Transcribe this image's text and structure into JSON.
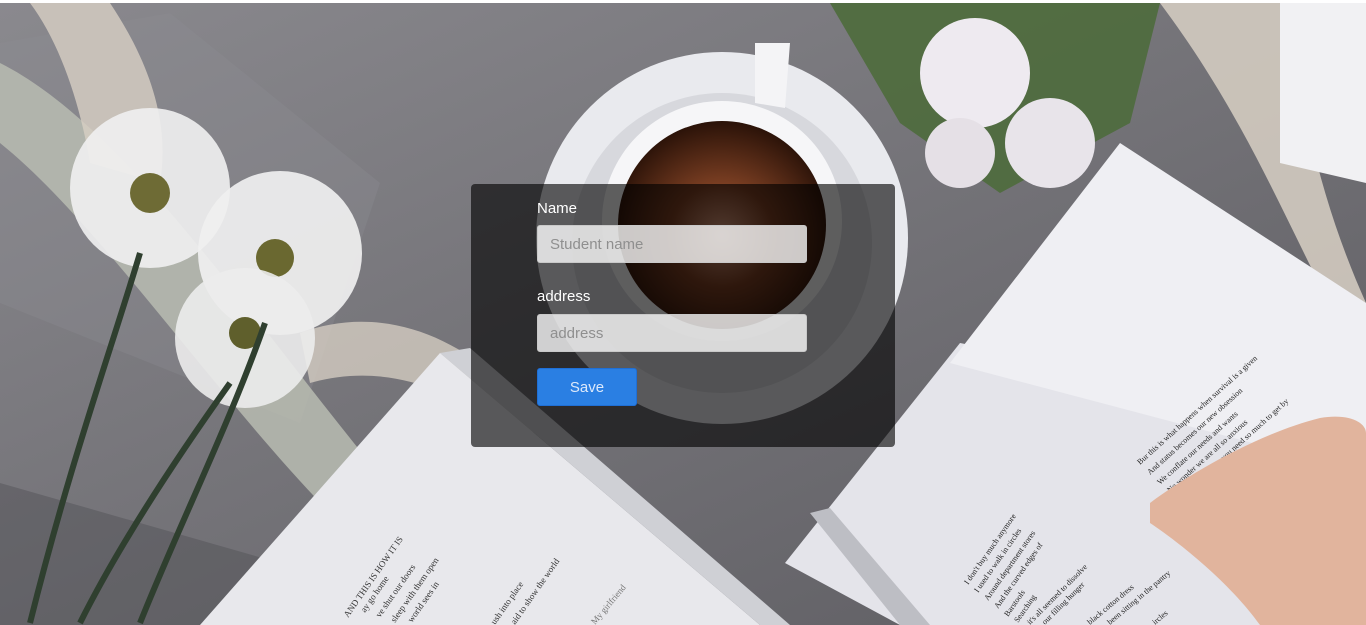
{
  "form": {
    "name_label": "Name",
    "name_placeholder": "Student name",
    "name_value": "",
    "address_label": "address",
    "address_placeholder": "address",
    "address_value": "",
    "save_label": "Save"
  },
  "background": {
    "left_book_lines": [
      "AND THIS IS HOW IT IS",
      "ay go home",
      "ve shut our doors",
      "sleep with them open",
      "world sees in",
      "ush into place",
      "aid to show the world",
      "My girlfriend"
    ],
    "right_book_lines": [
      "I don't buy much anymore",
      "I used to walk in circles",
      "Around department stores",
      "And the curved edges of",
      "Barstools",
      "Searching",
      "it's all seemed to dissolve",
      "our filling hunger",
      "black cotton dress",
      "been sitting in the pantry",
      "ircles",
      "Bur this is what happens when survival is a given",
      "And status becomes our new obsession",
      "We conflate our needs and wants",
      "No wonder we are all so anxious",
      "Forever believing you need so much to get by"
    ],
    "colors": {
      "panel": "#000000",
      "button": "#2a7fe3",
      "tablecloth": "#6f6e73"
    }
  }
}
